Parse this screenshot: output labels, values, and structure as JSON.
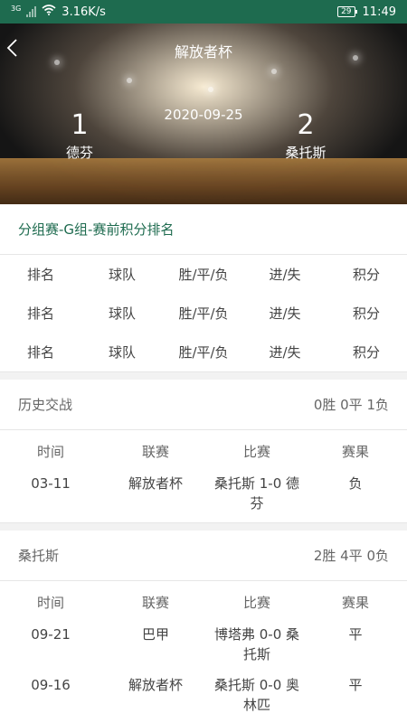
{
  "status_bar": {
    "network": "3G",
    "speed": "3.16K/s",
    "battery": "29",
    "time": "11:49"
  },
  "header": {
    "back_icon": "chevron-left-icon",
    "title": "解放者杯",
    "date": "2020-09-25",
    "home": {
      "score": "1",
      "name": "德芬"
    },
    "away": {
      "score": "2",
      "name": "桑托斯"
    }
  },
  "standings": {
    "title": "分组赛-G组-赛前积分排名",
    "columns": [
      "排名",
      "球队",
      "胜/平/负",
      "进/失",
      "积分"
    ],
    "rows": [
      [
        "排名",
        "球队",
        "胜/平/负",
        "进/失",
        "积分"
      ],
      [
        "排名",
        "球队",
        "胜/平/负",
        "进/失",
        "积分"
      ]
    ]
  },
  "history": {
    "label": "历史交战",
    "summary": "0胜 0平 1负",
    "columns": [
      "时间",
      "联赛",
      "比赛",
      "赛果"
    ],
    "rows": [
      [
        "03-11",
        "解放者杯",
        "桑托斯 1-0 德芬",
        "负"
      ]
    ]
  },
  "recent": {
    "label": "桑托斯",
    "summary": "2胜 4平 0负",
    "columns": [
      "时间",
      "联赛",
      "比赛",
      "赛果"
    ],
    "rows": [
      [
        "09-21",
        "巴甲",
        "博塔弗 0-0 桑托斯",
        "平"
      ],
      [
        "09-16",
        "解放者杯",
        "桑托斯 0-0 奥林匹",
        "平"
      ]
    ]
  }
}
